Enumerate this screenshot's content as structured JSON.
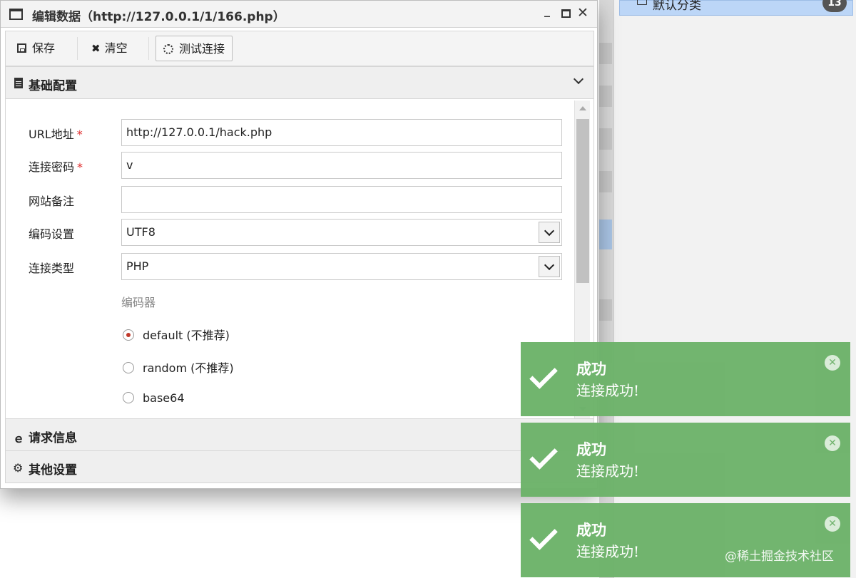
{
  "background": {
    "category_label": "默认分类",
    "category_count": "13"
  },
  "dialog": {
    "title": "编辑数据（http://127.0.0.1/1/166.php）",
    "toolbar": {
      "save_label": "保存",
      "clear_label": "清空",
      "test_label": "测试连接"
    },
    "sections": {
      "basic": "基础配置",
      "request": "请求信息",
      "other": "其他设置"
    },
    "form": {
      "url_label": "URL地址",
      "url_value": "http://127.0.0.1/hack.php",
      "password_label": "连接密码",
      "password_value": "v",
      "note_label": "网站备注",
      "note_value": "",
      "encoding_label": "编码设置",
      "encoding_value": "UTF8",
      "type_label": "连接类型",
      "type_value": "PHP",
      "encoder_title": "编码器",
      "encoders": [
        "default (不推荐)",
        "random (不推荐)",
        "base64"
      ],
      "selected_encoder": "default (不推荐)",
      "required_mark": "*"
    }
  },
  "toasts": [
    {
      "title": "成功",
      "message": "连接成功!"
    },
    {
      "title": "成功",
      "message": "连接成功!"
    },
    {
      "title": "成功",
      "message": "连接成功!"
    }
  ],
  "watermark": "@稀土掘金技术社区",
  "colors": {
    "toast_green": "#6db36a",
    "required_red": "#e02e2e",
    "selection_blue": "#bcd6f7"
  }
}
